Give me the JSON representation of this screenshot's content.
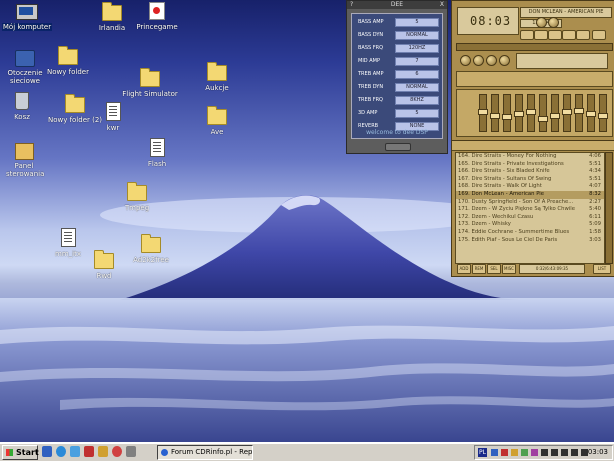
{
  "desktop": {
    "icons": [
      {
        "id": "moj-komputer",
        "label": "Mój komputer",
        "kind": "pc",
        "selected": true
      },
      {
        "id": "irlandia",
        "label": "Irlandia",
        "kind": "folder"
      },
      {
        "id": "princegame",
        "label": "Princegame",
        "kind": "game"
      },
      {
        "id": "otoczenie",
        "label": "Otoczenie sieciowe",
        "kind": "net"
      },
      {
        "id": "nowy-folder",
        "label": "Nowy folder",
        "kind": "folder"
      },
      {
        "id": "flight",
        "label": "Flight Simulator",
        "kind": "folder"
      },
      {
        "id": "aukcje",
        "label": "Aukcje",
        "kind": "folder"
      },
      {
        "id": "kosz",
        "label": "Kosz",
        "kind": "bin"
      },
      {
        "id": "nowy-folder-2",
        "label": "Nowy folder (2)",
        "kind": "folder"
      },
      {
        "id": "kwr",
        "label": "kwr",
        "kind": "doc"
      },
      {
        "id": "ave",
        "label": "Ave",
        "kind": "folder"
      },
      {
        "id": "panel",
        "label": "Panel sterowania",
        "kind": "panel"
      },
      {
        "id": "flash",
        "label": "Flash",
        "kind": "doc"
      },
      {
        "id": "tmpeg",
        "label": "Tmpeg",
        "kind": "folder"
      },
      {
        "id": "mm-itx",
        "label": "mm_itx",
        "kind": "doc"
      },
      {
        "id": "ad2k",
        "label": "Ad2k2free",
        "kind": "folder"
      },
      {
        "id": "rwd",
        "label": "Rwd",
        "kind": "folder"
      }
    ]
  },
  "dsp": {
    "title": "DEE",
    "left_glyph": "?",
    "close_glyph": "X",
    "rows": [
      {
        "name": "BASS AMP",
        "value": "5"
      },
      {
        "name": "BASS DYN",
        "value": "NORMAL"
      },
      {
        "name": "BASS FRQ",
        "value": "120HZ"
      },
      {
        "name": "MID AMP",
        "value": "7"
      },
      {
        "name": "TREB AMP",
        "value": "6"
      },
      {
        "name": "TREB DYN",
        "value": "NORMAL"
      },
      {
        "name": "TREB FRQ",
        "value": "8KHZ"
      },
      {
        "name": "3D AMP",
        "value": "5"
      },
      {
        "name": "REVERB",
        "value": "NONE"
      }
    ],
    "welcome": "welcome to dee DSP"
  },
  "winamp": {
    "time": "08:03",
    "ticker": "DON MCLEAN - AMERICAN PIE",
    "kbps": "128 44",
    "eq_levels": [
      0.55,
      0.45,
      0.4,
      0.5,
      0.55,
      0.35,
      0.45,
      0.55,
      0.6,
      0.5,
      0.45
    ]
  },
  "playlist": {
    "current_index": 5,
    "tracks": [
      {
        "title": "164. Dire Straits - Money For Nothing",
        "duration": "4:06"
      },
      {
        "title": "165. Dire Straits - Private Investigations",
        "duration": "5:51"
      },
      {
        "title": "166. Dire Straits - Six Bladed Knife",
        "duration": "4:34"
      },
      {
        "title": "167. Dire Straits - Sultans Of Swing",
        "duration": "5:51"
      },
      {
        "title": "168. Dire Straits - Walk Of Light",
        "duration": "4:07"
      },
      {
        "title": "169. Don McLean - American Pie",
        "duration": "8:32"
      },
      {
        "title": "170. Dusty Springfield - Son Of A Preache...",
        "duration": "2:27"
      },
      {
        "title": "171. Dzem - W Życiu Piękne Są Tylko Chwile",
        "duration": "5:40"
      },
      {
        "title": "172. Dzem - Wechikul Czasu",
        "duration": "6:11"
      },
      {
        "title": "173. Dzem - Whisky",
        "duration": "5:09"
      },
      {
        "title": "174. Eddie Cochrane - Summertime Blues",
        "duration": "1:58"
      },
      {
        "title": "175. Edith Piaf - Sous Le Ciel De Paris",
        "duration": "3:03"
      }
    ],
    "buttons": [
      "ADD",
      "REM",
      "SEL",
      "MISC"
    ],
    "list_button": "LIST",
    "footer_time": "0:32/6:43:09:35"
  },
  "taskbar": {
    "start_label": "Start",
    "task_label": "Forum CDRinfo.pl - Reply t...",
    "clock": "03:03",
    "lang": "PL"
  }
}
